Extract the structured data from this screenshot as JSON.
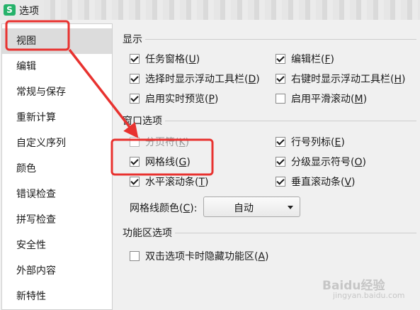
{
  "window": {
    "app_icon_letter": "S",
    "title": "选项"
  },
  "sidebar": {
    "items": [
      {
        "label": "视图",
        "selected": true
      },
      {
        "label": "编辑"
      },
      {
        "label": "常规与保存"
      },
      {
        "label": "重新计算"
      },
      {
        "label": "自定义序列"
      },
      {
        "label": "颜色"
      },
      {
        "label": "错误检查"
      },
      {
        "label": "拼写检查"
      },
      {
        "label": "安全性"
      },
      {
        "label": "外部内容"
      },
      {
        "label": "新特性"
      }
    ]
  },
  "display": {
    "heading": "显示",
    "options": [
      {
        "text": "任务窗格",
        "key": "U",
        "checked": true
      },
      {
        "text": "编辑栏",
        "key": "F",
        "checked": true
      },
      {
        "text": "选择时显示浮动工具栏",
        "key": "D",
        "checked": true
      },
      {
        "text": "右键时显示浮动工具栏",
        "key": "H",
        "checked": true
      },
      {
        "text": "启用实时预览",
        "key": "P",
        "checked": true
      },
      {
        "text": "启用平滑滚动",
        "key": "M",
        "checked": false
      }
    ]
  },
  "window_options": {
    "heading": "窗口选项",
    "options": [
      {
        "text": "分页符",
        "key": "K",
        "checked": false
      },
      {
        "text": "行号列标",
        "key": "E",
        "checked": true
      },
      {
        "text": "网格线",
        "key": "G",
        "checked": true
      },
      {
        "text": "分级显示符号",
        "key": "O",
        "checked": true
      },
      {
        "text": "水平滚动条",
        "key": "T",
        "checked": true
      },
      {
        "text": "垂直滚动条",
        "key": "V",
        "checked": true
      }
    ],
    "gridline_color": {
      "label": "网格线颜色",
      "key": "C",
      "value": "自动"
    }
  },
  "ribbon": {
    "heading": "功能区选项",
    "options": [
      {
        "text": "双击选项卡时隐藏功能区",
        "key": "A",
        "checked": false
      }
    ]
  },
  "watermark": {
    "brand": "Baidu经验",
    "url": "jingyan.baidu.com"
  },
  "annotation_color": "#e8322f"
}
